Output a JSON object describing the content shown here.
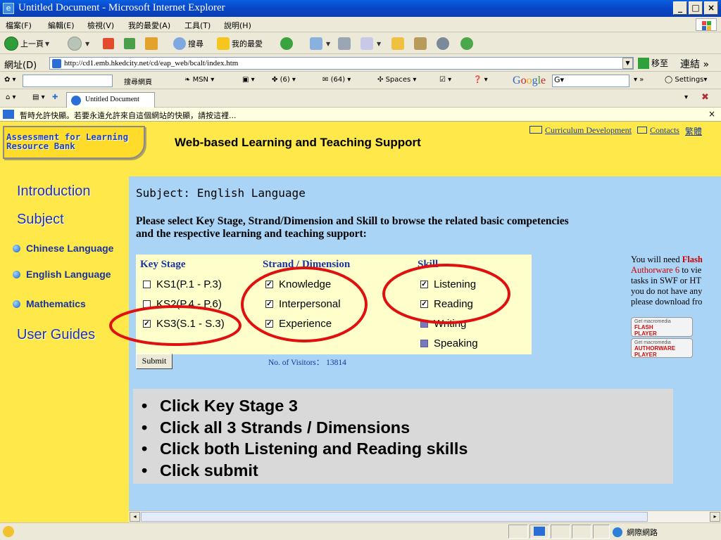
{
  "window": {
    "title": "Untitled Document - Microsoft Internet Explorer",
    "min": "_",
    "max": "□",
    "close": "×"
  },
  "menu": [
    "檔案(F)",
    "編輯(E)",
    "檢視(V)",
    "我的最愛(A)",
    "工具(T)",
    "說明(H)"
  ],
  "toolbar": {
    "back": "上一頁",
    "search": "搜尋",
    "favorites": "我的最愛"
  },
  "address": {
    "label": "網址(D)",
    "url": "http://cd1.emb.hkedcity.net/cd/eap_web/bcalt/index.htm",
    "go": "移至",
    "links": "連結 »"
  },
  "linkbar": {
    "search": "搜尋網頁",
    "msn": "MSN",
    "mail": "(6)",
    "inbox": "(64)",
    "spaces": "Spaces",
    "google_field": "G▾",
    "settings": "Settings▾"
  },
  "tab": {
    "label": "Untitled Document"
  },
  "infobar": {
    "text": "暫時允許快顯。若要永遠允許來自這個網站的快顯，請按這裡...",
    "close": "×"
  },
  "page": {
    "logo_line1": "Assessment for Learning",
    "logo_line2": "Resource Bank",
    "site_title": "Web-based Learning and Teaching Support",
    "header_links": {
      "curriculum": "Curriculum Development",
      "contacts": "Contacts",
      "lang": "繁體"
    },
    "sidebar": {
      "introduction": "Introduction",
      "subject": "Subject",
      "subjects": [
        "Chinese Language",
        "English Language",
        "Mathematics"
      ],
      "user_guides": "User Guides"
    },
    "subject_line": "Subject: English Language",
    "instructions": "Please select Key Stage, Strand/Dimension and Skill to browse the related basic competencies and the respective learning and teaching support:",
    "key_stage": {
      "heading": "Key Stage",
      "options": [
        {
          "label": "KS1(P.1 - P.3)",
          "checked": false
        },
        {
          "label": "KS2(P.4 - P.6)",
          "checked": false
        },
        {
          "label": "KS3(S.1 - S.3)",
          "checked": true
        }
      ]
    },
    "strand": {
      "heading": "Strand / Dimension",
      "options": [
        {
          "label": "Knowledge",
          "checked": true
        },
        {
          "label": "Interpersonal",
          "checked": true
        },
        {
          "label": "Experience",
          "checked": true
        }
      ]
    },
    "skill": {
      "heading": "Skill",
      "options": [
        {
          "label": "Listening",
          "checked": true
        },
        {
          "label": "Reading",
          "checked": true
        },
        {
          "label": "Writing",
          "checked": false
        },
        {
          "label": "Speaking",
          "checked": false
        }
      ]
    },
    "submit": "Submit",
    "visitors": "No. of Visitors： 13814",
    "right_note": {
      "l1a": "You will need ",
      "l1b": "Flash",
      "l2a": "Authorware 6",
      "l2b": " to vie",
      "l3": "tasks in SWF or HT",
      "l4": "you do not have any",
      "l5": "please download fro"
    },
    "badge_flash": {
      "top": "Get macromedia",
      "name": "FLASH",
      "sub": "PLAYER"
    },
    "badge_aw": {
      "top": "Get macromedia",
      "name": "AUTHORWARE",
      "sub": "PLAYER"
    }
  },
  "callout": {
    "bullet": "•",
    "items": [
      "Click  Key Stage 3",
      "Click  all 3 Strands / Dimensions",
      "Click  both  Listening and Reading skills",
      "Click  submit"
    ]
  },
  "status": {
    "zone": "網際網路"
  },
  "colors": {
    "accent_red": "#e01010",
    "header_yellow": "#ffe94a",
    "page_blue": "#a9d4f6",
    "link_blue": "#1a33a0"
  }
}
